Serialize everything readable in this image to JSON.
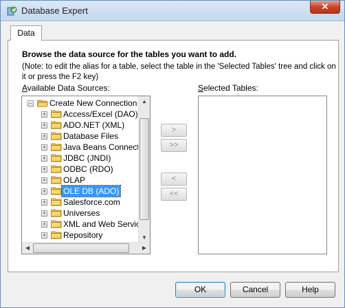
{
  "window": {
    "title": "Database Expert",
    "close_glyph": "✕"
  },
  "tabs": [
    {
      "label": "Data"
    }
  ],
  "panel": {
    "heading": "Browse the data source for the tables you want to add.",
    "note": "(Note: to edit the alias for a table, select the table in the 'Selected Tables' tree and click on it or press the F2 key)",
    "available_label": "Available Data Sources:",
    "selected_label": "Selected Tables:"
  },
  "tree": {
    "root": {
      "label": "Create New Connection",
      "expander": "−",
      "icon": "folder-open-icon"
    },
    "items": [
      {
        "label": "Access/Excel (DAO)",
        "expander": "+"
      },
      {
        "label": "ADO.NET (XML)",
        "expander": "+"
      },
      {
        "label": "Database Files",
        "expander": "+"
      },
      {
        "label": "Java Beans Connectivit",
        "expander": "+"
      },
      {
        "label": "JDBC (JNDI)",
        "expander": "+"
      },
      {
        "label": "ODBC (RDO)",
        "expander": "+"
      },
      {
        "label": "OLAP",
        "expander": "+"
      },
      {
        "label": "OLE DB (ADO)",
        "expander": "+",
        "selected": true
      },
      {
        "label": "Salesforce.com",
        "expander": "+"
      },
      {
        "label": "Universes",
        "expander": "+"
      },
      {
        "label": "XML and Web Services",
        "expander": "+"
      },
      {
        "label": "Repository",
        "expander": "+"
      }
    ]
  },
  "move_buttons": {
    "add": ">",
    "add_all": ">>",
    "remove": "<",
    "remove_all": "<<"
  },
  "buttons": {
    "ok": "OK",
    "cancel": "Cancel",
    "help": "Help"
  },
  "colors": {
    "selection": "#3399ff",
    "folder": "#f4c542"
  }
}
